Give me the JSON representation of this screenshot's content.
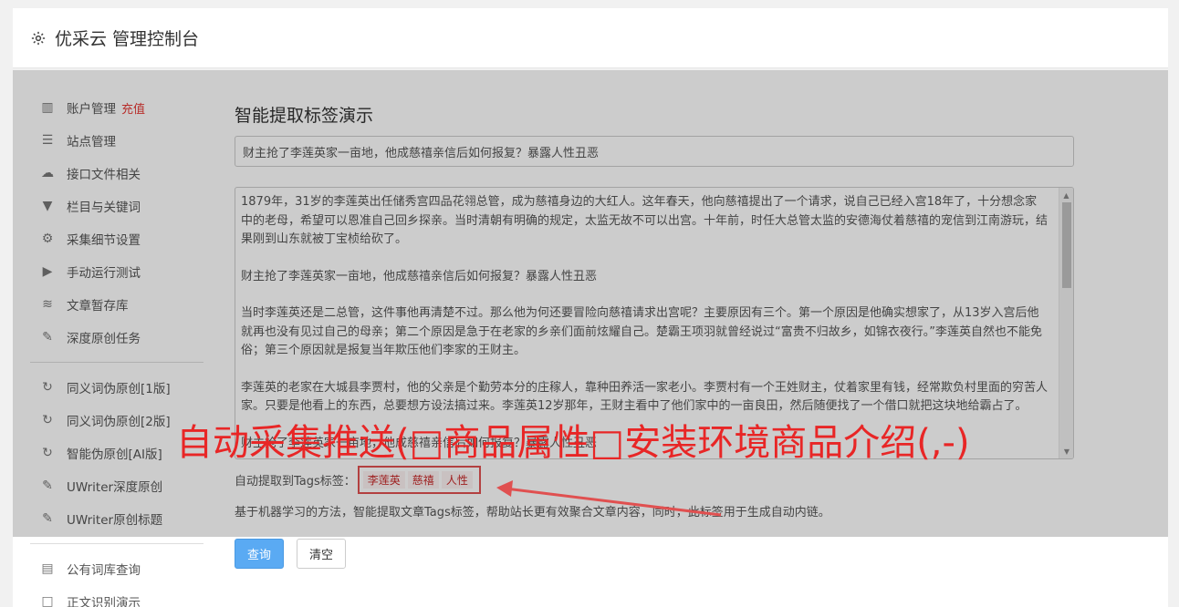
{
  "app": {
    "title": "优采云 管理控制台",
    "icon": "gear-icon"
  },
  "sidebar": {
    "group1": [
      {
        "label": "账户管理",
        "badge": "充值",
        "icon": "bar-chart-icon"
      },
      {
        "label": "站点管理",
        "icon": "server-icon"
      },
      {
        "label": "接口文件相关",
        "icon": "cloud-upload-icon"
      },
      {
        "label": "栏目与关键词",
        "icon": "filter-icon"
      },
      {
        "label": "采集细节设置",
        "icon": "cogs-icon"
      },
      {
        "label": "手动运行测试",
        "icon": "play-circle-icon"
      },
      {
        "label": "文章暂存库",
        "icon": "database-icon"
      },
      {
        "label": "深度原创任务",
        "icon": "edit-icon"
      }
    ],
    "group2": [
      {
        "label": "同义词伪原创[1版]",
        "icon": "refresh-icon"
      },
      {
        "label": "同义词伪原创[2版]",
        "icon": "refresh-icon"
      },
      {
        "label": "智能伪原创[AI版]",
        "icon": "refresh-icon"
      },
      {
        "label": "UWriter深度原创",
        "icon": "edit-icon"
      },
      {
        "label": "UWriter原创标题",
        "icon": "edit-icon"
      }
    ],
    "group3": [
      {
        "label": "公有词库查询",
        "icon": "book-icon"
      },
      {
        "label": "正文识别演示",
        "icon": "square-icon"
      }
    ]
  },
  "main": {
    "page_title": "智能提取标签演示",
    "title_value": "财主抢了李莲英家一亩地，他成慈禧亲信后如何报复？暴露人性丑恶",
    "content_paragraphs": [
      "1879年，31岁的李莲英出任储秀宫四品花翎总管，成为慈禧身边的大红人。这年春天，他向慈禧提出了一个请求，说自己已经入宫18年了，十分想念家中的老母，希望可以恩准自己回乡探亲。当时清朝有明确的规定，太监无故不可以出宫。十年前，时任大总管太监的安德海仗着慈禧的宠信到江南游玩，结果刚到山东就被丁宝桢给砍了。",
      "财主抢了李莲英家一亩地，他成慈禧亲信后如何报复？暴露人性丑恶",
      "当时李莲英还是二总管，这件事他再清楚不过。那么他为何还要冒险向慈禧请求出宫呢？主要原因有三个。第一个原因是他确实想家了，从13岁入宫后他就再也没有见过自己的母亲；第二个原因是急于在老家的乡亲们面前炫耀自己。楚霸王项羽就曾经说过“富贵不归故乡，如锦衣夜行。”李莲英自然也不能免俗；第三个原因就是报复当年欺压他们李家的王财主。",
      "李莲英的老家在大城县李贾村，他的父亲是个勤劳本分的庄稼人，靠种田养活一家老小。李贾村有一个王姓财主，仗着家里有钱，经常欺负村里面的穷苦人家。只要是他看上的东西，总要想方设法搞过来。李莲英12岁那年，王财主看中了他们家中的一亩良田，然后随便找了一个借口就把这块地给霸占了。",
      "财主抢了李莲英家一亩地，他成慈禧亲信后如何报复？暴露人性丑恶"
    ],
    "tags_label": "自动提取到Tags标签：",
    "tags": [
      "李莲英",
      "慈禧",
      "人性"
    ],
    "description": "基于机器学习的方法，智能提取文章Tags标签，帮助站长更有效聚合文章内容，同时，此标签用于生成自动内链。",
    "query_button": "查询",
    "clear_button": "清空"
  },
  "watermark": "自动采集推送(□商品属性□安装环境商品介绍(,-)",
  "colors": {
    "accent": "#5aaaf3",
    "watermark": "#e82626",
    "tag": "#c62828"
  }
}
